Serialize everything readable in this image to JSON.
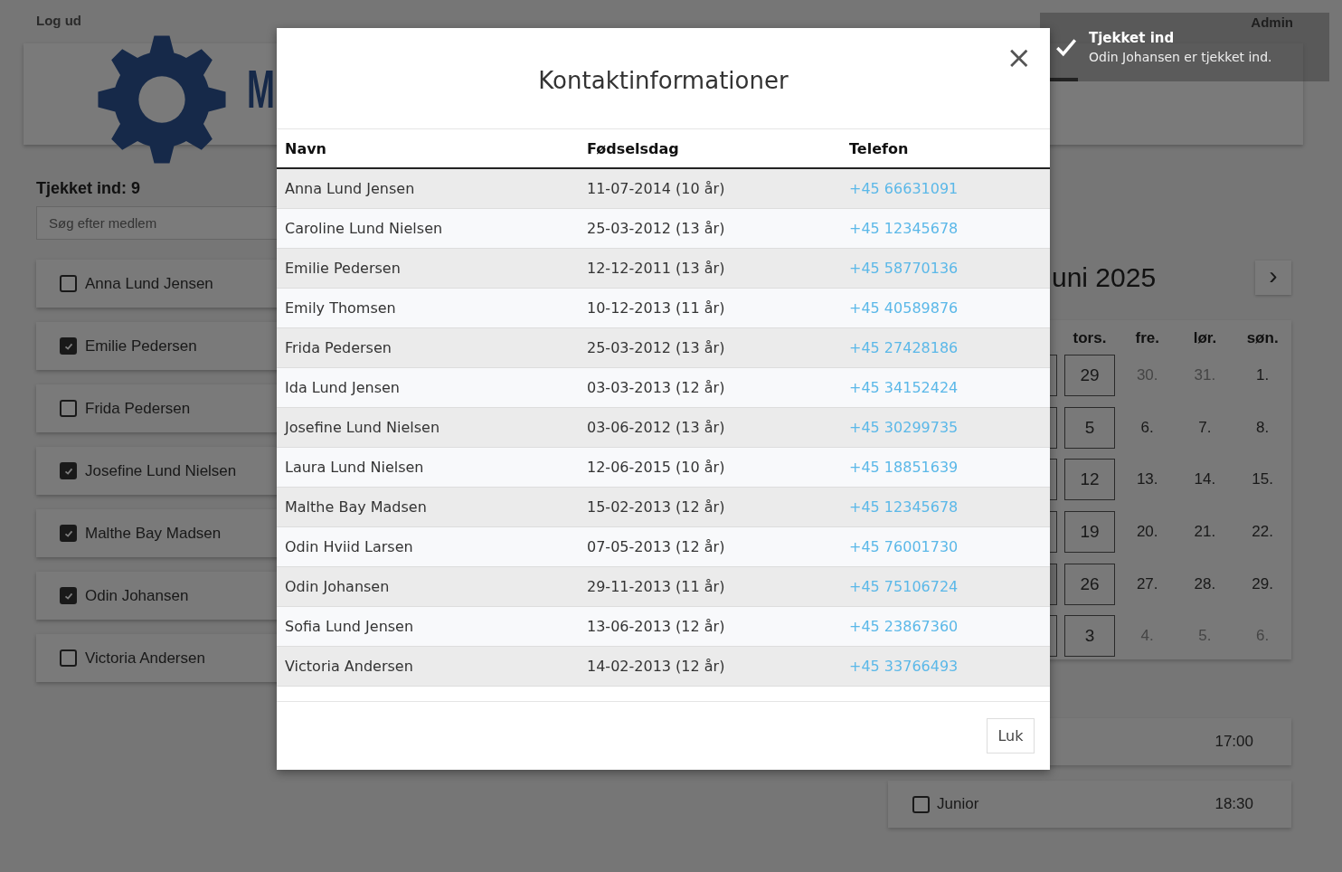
{
  "page": {
    "logout": "Log ud",
    "admin": "Admin",
    "logo_text": "M"
  },
  "checked_in": {
    "label": "Tjekket ind: 9"
  },
  "search": {
    "placeholder": "Søg efter medlem"
  },
  "members": [
    {
      "name": "Anna Lund Jensen",
      "checked": false
    },
    {
      "name": "Emilie Pedersen",
      "checked": true
    },
    {
      "name": "Frida Pedersen",
      "checked": false
    },
    {
      "name": "Josefine Lund Nielsen",
      "checked": true
    },
    {
      "name": "Malthe Bay Madsen",
      "checked": true
    },
    {
      "name": "Odin Johansen",
      "checked": true
    },
    {
      "name": "Victoria Andersen",
      "checked": false
    }
  ],
  "calendar": {
    "month": "uni 2025",
    "next": "›",
    "weekdays": [
      "tors.",
      "fre.",
      "lør.",
      "søn."
    ],
    "weeks": [
      [
        {
          "kind": "session"
        },
        {
          "day": "29",
          "kind": "session"
        },
        {
          "day": "30.",
          "kind": "other"
        },
        {
          "day": "31.",
          "kind": "other"
        },
        {
          "day": "1.",
          "kind": "day"
        }
      ],
      [
        {
          "kind": "session"
        },
        {
          "day": "5",
          "kind": "session"
        },
        {
          "day": "6.",
          "kind": "day"
        },
        {
          "day": "7.",
          "kind": "day"
        },
        {
          "day": "8.",
          "kind": "day"
        }
      ],
      [
        {
          "kind": "session"
        },
        {
          "day": "12",
          "kind": "session"
        },
        {
          "day": "13.",
          "kind": "day"
        },
        {
          "day": "14.",
          "kind": "day"
        },
        {
          "day": "15.",
          "kind": "day"
        }
      ],
      [
        {
          "kind": "session"
        },
        {
          "day": "19",
          "kind": "session"
        },
        {
          "day": "20.",
          "kind": "day"
        },
        {
          "day": "21.",
          "kind": "day"
        },
        {
          "day": "22.",
          "kind": "day"
        }
      ],
      [
        {
          "kind": "today"
        },
        {
          "day": "26",
          "kind": "session"
        },
        {
          "day": "27.",
          "kind": "day"
        },
        {
          "day": "28.",
          "kind": "day"
        },
        {
          "day": "29.",
          "kind": "day"
        }
      ],
      [
        {
          "kind": "session"
        },
        {
          "day": "3",
          "kind": "session"
        },
        {
          "day": "4.",
          "kind": "other"
        },
        {
          "day": "5.",
          "kind": "other"
        },
        {
          "day": "6.",
          "kind": "other"
        }
      ]
    ]
  },
  "sessions": [
    {
      "time": "17:00"
    },
    {
      "label": "Junior",
      "time": "18:30",
      "checked": false
    }
  ],
  "toast": {
    "title": "Tjekket ind",
    "message": "Odin Johansen er tjekket ind.",
    "level": 0.13
  },
  "modal": {
    "title": "Kontaktinformationer",
    "close": "×",
    "columns": [
      "Navn",
      "Fødselsdag",
      "Telefon"
    ],
    "rows": [
      [
        "Anna Lund Jensen",
        "11-07-2014 (10 år)",
        "+45 66631091"
      ],
      [
        "Caroline Lund Nielsen",
        "25-03-2012 (13 år)",
        "+45 12345678"
      ],
      [
        "Emilie Pedersen",
        "12-12-2011 (13 år)",
        "+45 58770136"
      ],
      [
        "Emily Thomsen",
        "10-12-2013 (11 år)",
        "+45 40589876"
      ],
      [
        "Frida Pedersen",
        "25-03-2012 (13 år)",
        "+45 27428186"
      ],
      [
        "Ida Lund Jensen",
        "03-03-2013 (12 år)",
        "+45 34152424"
      ],
      [
        "Josefine Lund Nielsen",
        "03-06-2012 (13 år)",
        "+45 30299735"
      ],
      [
        "Laura Lund Nielsen",
        "12-06-2015 (10 år)",
        "+45 18851639"
      ],
      [
        "Malthe Bay Madsen",
        "15-02-2013 (12 år)",
        "+45 12345678"
      ],
      [
        "Odin Hviid Larsen",
        "07-05-2013 (12 år)",
        "+45 76001730"
      ],
      [
        "Odin Johansen",
        "29-11-2013 (11 år)",
        "+45 75106724"
      ],
      [
        "Sofia Lund Jensen",
        "13-06-2013 (12 år)",
        "+45 23867360"
      ],
      [
        "Victoria Andersen",
        "14-02-2013 (12 år)",
        "+45 33766493"
      ]
    ],
    "button": "Luk"
  }
}
